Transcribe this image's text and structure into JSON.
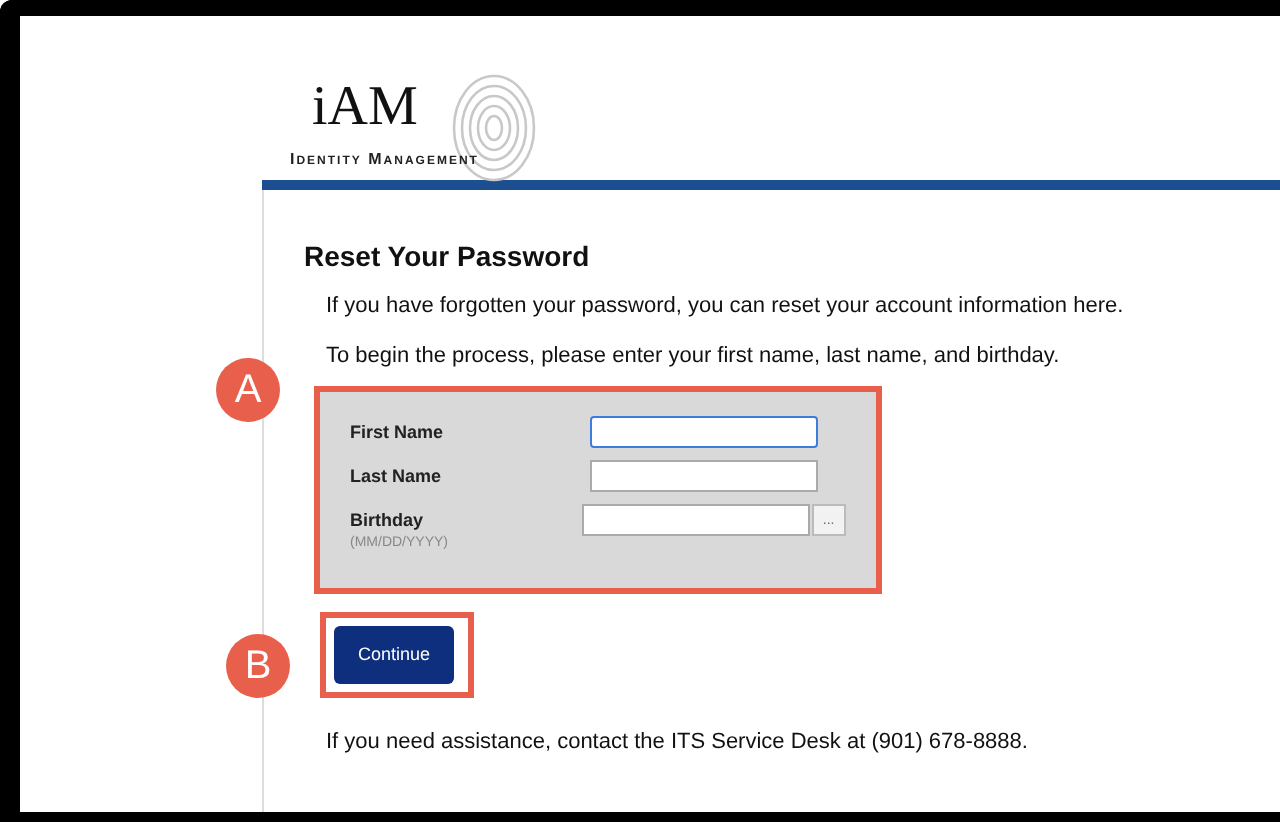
{
  "logo": {
    "title": "iAM",
    "subtitle": "Identity Management"
  },
  "heading": "Reset Your Password",
  "intro": [
    "If you have forgotten your password, you can reset your account information here.",
    "To begin the process, please enter your first name, last name, and birthday."
  ],
  "fields": [
    {
      "label": "First Name",
      "focused": true,
      "kind": "text"
    },
    {
      "label": "Last Name",
      "focused": false,
      "kind": "text"
    },
    {
      "label": "Birthday",
      "hint": "(MM/DD/YYYY)",
      "focused": false,
      "kind": "date",
      "picker": "..."
    }
  ],
  "continue_button": "Continue",
  "callouts": [
    {
      "letter": "A"
    },
    {
      "letter": "B"
    }
  ],
  "footer": "If you need assistance, contact the ITS Service Desk at (901) 678-8888."
}
